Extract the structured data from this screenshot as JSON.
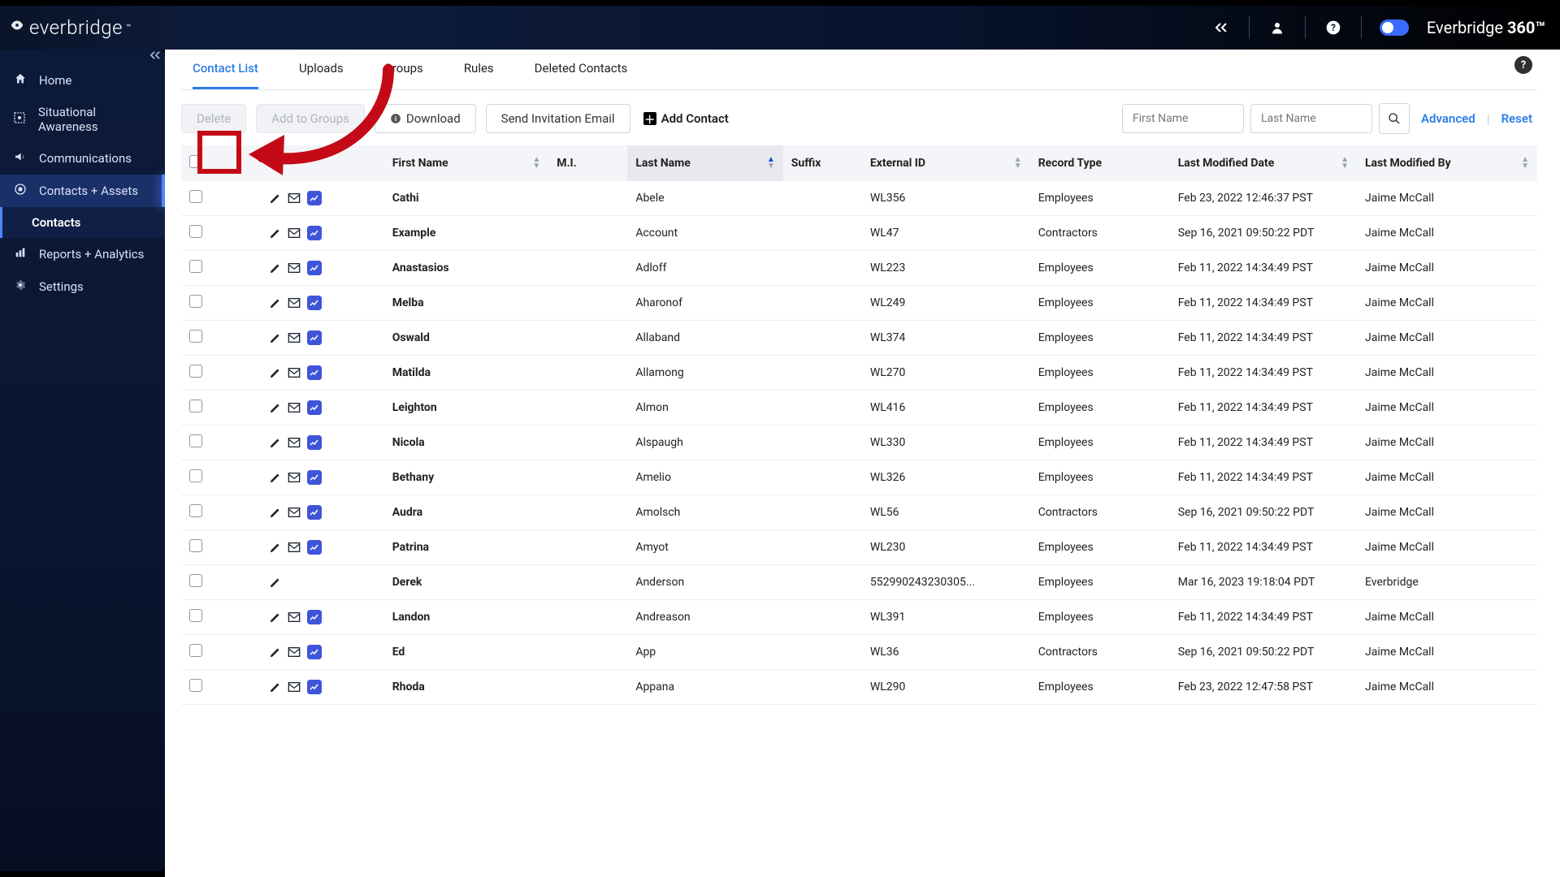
{
  "header": {
    "logo_text": "everbridge",
    "brand360_a": "Everbridge ",
    "brand360_b": "360™"
  },
  "sidebar": {
    "items": [
      {
        "label": "Home",
        "icon": "home"
      },
      {
        "label": "Situational Awareness",
        "icon": "situational"
      },
      {
        "label": "Communications",
        "icon": "comm"
      },
      {
        "label": "Contacts + Assets",
        "icon": "contacts",
        "active_parent": true
      },
      {
        "label": "Contacts",
        "sub": true
      },
      {
        "label": "Reports + Analytics",
        "icon": "reports"
      },
      {
        "label": "Settings",
        "icon": "settings"
      }
    ]
  },
  "tabs": {
    "items": [
      "Contact List",
      "Uploads",
      "Groups",
      "Rules",
      "Deleted Contacts"
    ],
    "active": 0
  },
  "actions": {
    "delete": "Delete",
    "add_to_groups": "Add to Groups",
    "download": "Download",
    "send_invite": "Send Invitation Email",
    "add_contact": "Add Contact"
  },
  "search": {
    "first_ph": "First Name",
    "last_ph": "Last Name",
    "advanced": "Advanced",
    "reset": "Reset"
  },
  "columns": {
    "first": "First Name",
    "mi": "M.I.",
    "last": "Last Name",
    "suffix": "Suffix",
    "external": "External ID",
    "record": "Record Type",
    "modified_date": "Last Modified Date",
    "modified_by": "Last Modified By"
  },
  "rows": [
    {
      "first": "Cathi",
      "last": "Abele",
      "ext": "WL356",
      "rec": "Employees",
      "date": "Feb 23, 2022 12:46:37 PST",
      "by": "Jaime McCall",
      "actions": 3
    },
    {
      "first": "Example",
      "last": "Account",
      "ext": "WL47",
      "rec": "Contractors",
      "date": "Sep 16, 2021 09:50:22 PDT",
      "by": "Jaime McCall",
      "actions": 3
    },
    {
      "first": "Anastasios",
      "last": "Adloff",
      "ext": "WL223",
      "rec": "Employees",
      "date": "Feb 11, 2022 14:34:49 PST",
      "by": "Jaime McCall",
      "actions": 3
    },
    {
      "first": "Melba",
      "last": "Aharonof",
      "ext": "WL249",
      "rec": "Employees",
      "date": "Feb 11, 2022 14:34:49 PST",
      "by": "Jaime McCall",
      "actions": 3
    },
    {
      "first": "Oswald",
      "last": "Allaband",
      "ext": "WL374",
      "rec": "Employees",
      "date": "Feb 11, 2022 14:34:49 PST",
      "by": "Jaime McCall",
      "actions": 3
    },
    {
      "first": "Matilda",
      "last": "Allamong",
      "ext": "WL270",
      "rec": "Employees",
      "date": "Feb 11, 2022 14:34:49 PST",
      "by": "Jaime McCall",
      "actions": 3
    },
    {
      "first": "Leighton",
      "last": "Almon",
      "ext": "WL416",
      "rec": "Employees",
      "date": "Feb 11, 2022 14:34:49 PST",
      "by": "Jaime McCall",
      "actions": 3
    },
    {
      "first": "Nicola",
      "last": "Alspaugh",
      "ext": "WL330",
      "rec": "Employees",
      "date": "Feb 11, 2022 14:34:49 PST",
      "by": "Jaime McCall",
      "actions": 3
    },
    {
      "first": "Bethany",
      "last": "Amelio",
      "ext": "WL326",
      "rec": "Employees",
      "date": "Feb 11, 2022 14:34:49 PST",
      "by": "Jaime McCall",
      "actions": 3
    },
    {
      "first": "Audra",
      "last": "Amolsch",
      "ext": "WL56",
      "rec": "Contractors",
      "date": "Sep 16, 2021 09:50:22 PDT",
      "by": "Jaime McCall",
      "actions": 3
    },
    {
      "first": "Patrina",
      "last": "Amyot",
      "ext": "WL230",
      "rec": "Employees",
      "date": "Feb 11, 2022 14:34:49 PST",
      "by": "Jaime McCall",
      "actions": 3
    },
    {
      "first": "Derek",
      "last": "Anderson",
      "ext": "552990243230305...",
      "rec": "Employees",
      "date": "Mar 16, 2023 19:18:04 PDT",
      "by": "Everbridge",
      "actions": 1
    },
    {
      "first": "Landon",
      "last": "Andreason",
      "ext": "WL391",
      "rec": "Employees",
      "date": "Feb 11, 2022 14:34:49 PST",
      "by": "Jaime McCall",
      "actions": 3
    },
    {
      "first": "Ed",
      "last": "App",
      "ext": "WL36",
      "rec": "Contractors",
      "date": "Sep 16, 2021 09:50:22 PDT",
      "by": "Jaime McCall",
      "actions": 3
    },
    {
      "first": "Rhoda",
      "last": "Appana",
      "ext": "WL290",
      "rec": "Employees",
      "date": "Feb 23, 2022 12:47:58 PST",
      "by": "Jaime McCall",
      "actions": 3
    }
  ]
}
